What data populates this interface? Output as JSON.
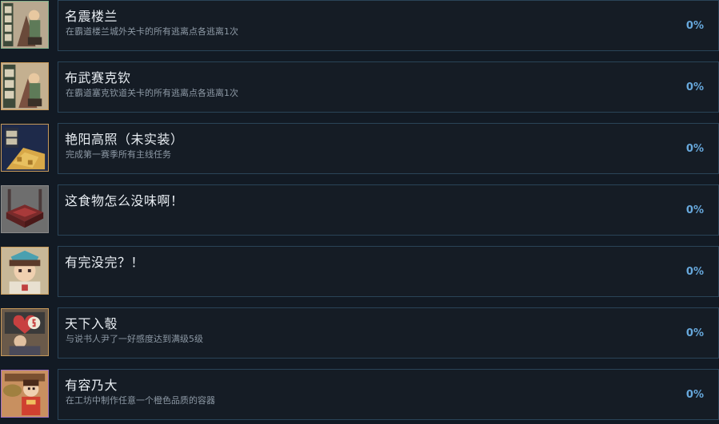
{
  "achievements": [
    {
      "title": "名震楼兰",
      "description": "在霸道楼兰城外关卡的所有逃离点各逃离1次",
      "percent": "0%",
      "icon": "loulan-gate-icon",
      "border": "#7fb08a",
      "bg": "#b8a890"
    },
    {
      "title": "布武赛克钦",
      "description": "在霸道塞克钦道关卡的所有逃离点各逃离1次",
      "percent": "0%",
      "icon": "saikeqin-road-icon",
      "border": "#c89a5a",
      "bg": "#c4b090"
    },
    {
      "title": "艳阳高照（未实装）",
      "description": "完成第一赛季所有主线任务",
      "percent": "0%",
      "icon": "golden-sun-icon",
      "border": "#c89a5a",
      "bg": "#1e2a4a"
    },
    {
      "title": "这食物怎么没味啊！",
      "description": "",
      "percent": "0%",
      "icon": "food-table-icon",
      "border": "#8a8a8a",
      "bg": "#6e6e6e"
    },
    {
      "title": "有完没完？！",
      "description": "",
      "percent": "0%",
      "icon": "angry-character-icon",
      "border": "#c89a5a",
      "bg": "#c8b898"
    },
    {
      "title": "天下入彀",
      "description": "与说书人尹了一好感度达到满级5级",
      "percent": "0%",
      "icon": "storyteller-heart-icon",
      "border": "#c89a5a",
      "bg": "#6a5a4a"
    },
    {
      "title": "有容乃大",
      "description": "在工坊中制作任意一个橙色品质的容器",
      "percent": "0%",
      "icon": "workshop-container-icon",
      "border": "#a070c0",
      "bg": "#c89060"
    }
  ]
}
